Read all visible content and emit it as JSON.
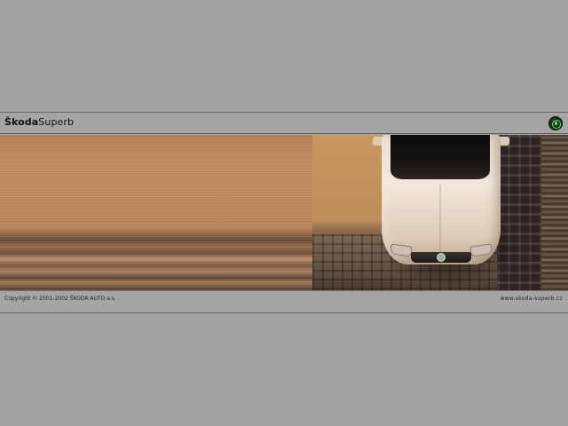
{
  "header": {
    "brand_bold": "Škoda",
    "brand_light": "Superb",
    "logo_icon": "skoda-logo-icon"
  },
  "banner": {
    "image": "car-top-view-on-cobblestone"
  },
  "footer": {
    "copyright": "Copyright © 2001-2002 ŠKODA AUTO a.s.",
    "website": "www.skoda-superb.cz"
  },
  "colors": {
    "page_background": "#a3a3a3",
    "bar_background": "#a5a5a5",
    "text": "#111111"
  }
}
